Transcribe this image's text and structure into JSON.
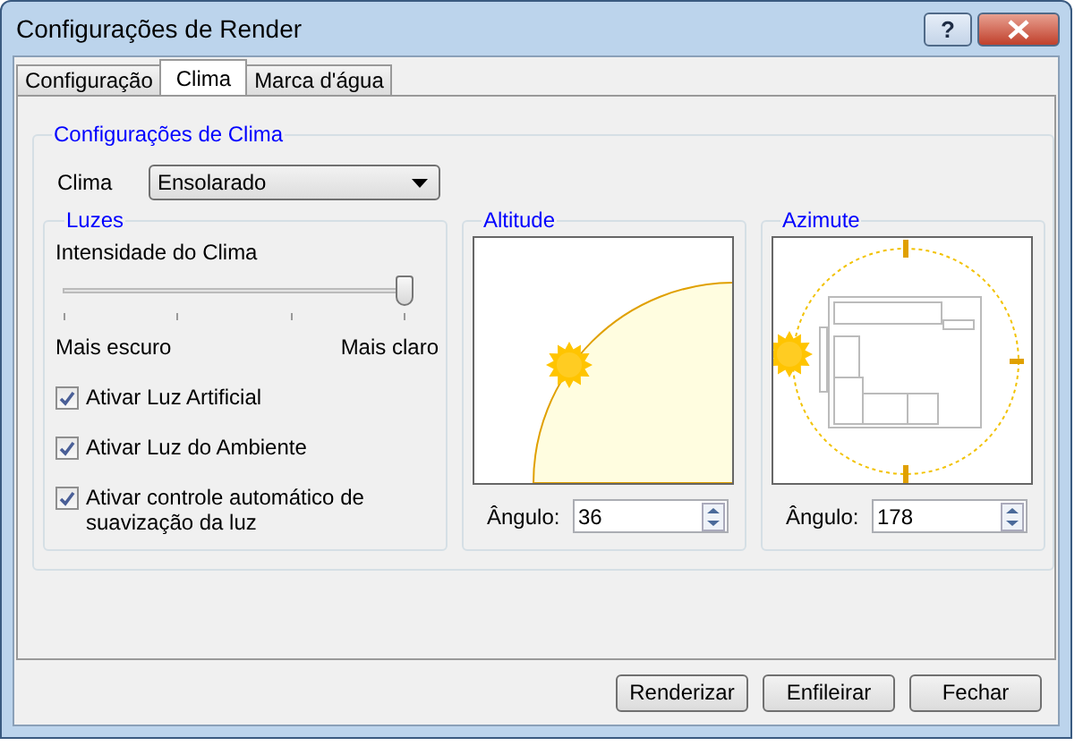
{
  "window": {
    "title": "Configurações de Render",
    "help": "?"
  },
  "tabs": [
    {
      "label": "Configuração",
      "selected": false
    },
    {
      "label": "Clima",
      "selected": true
    },
    {
      "label": "Marca d'água",
      "selected": false
    }
  ],
  "group_title": "Configurações de Clima",
  "clima": {
    "label": "Clima",
    "value": "Ensolarado"
  },
  "luzes": {
    "title": "Luzes",
    "slider": {
      "label": "Intensidade do Clima",
      "level": 1,
      "min_label": "Mais escuro",
      "max_label": "Mais claro"
    },
    "checkboxes": [
      {
        "label": "Ativar Luz Artificial",
        "checked": true
      },
      {
        "label": "Ativar Luz do Ambiente",
        "checked": true
      },
      {
        "label": "Ativar controle automático de suavização da luz",
        "checked": true
      }
    ]
  },
  "altitude": {
    "title": "Altitude",
    "angle_label": "Ângulo:",
    "angle": "36"
  },
  "azimute": {
    "title": "Azimute",
    "angle_label": "Ângulo:",
    "angle": "178"
  },
  "buttons": [
    "Renderizar",
    "Enfileirar",
    "Fechar"
  ]
}
